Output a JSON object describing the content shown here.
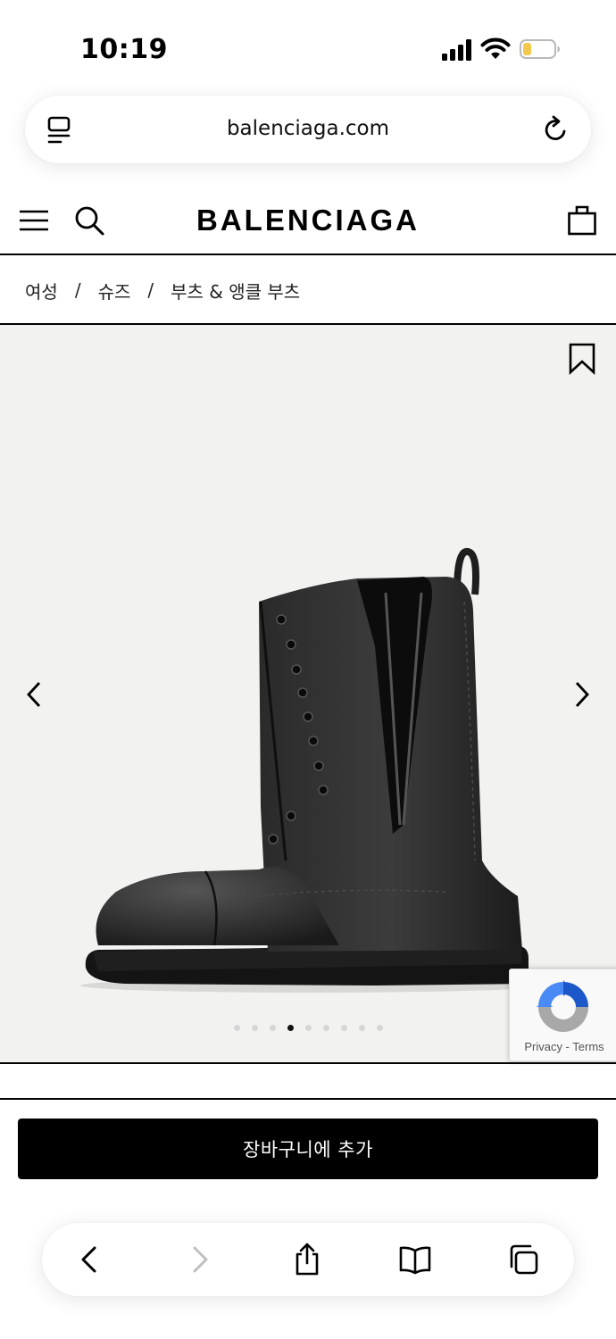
{
  "status_bar": {
    "time": "10:19",
    "icons": [
      "cellular-signal-icon",
      "wifi-icon",
      "battery-low-icon"
    ],
    "battery_color": "#f2c94c"
  },
  "browser": {
    "url": "balenciaga.com",
    "icons": [
      "tab-overview-icon",
      "reload-icon"
    ]
  },
  "header": {
    "brand": "BALENCIAGA",
    "icons": [
      "hamburger-menu-icon",
      "search-icon",
      "shopping-bag-icon"
    ]
  },
  "breadcrumb": {
    "items": [
      "여성",
      "슈즈",
      "부츠 & 앵클 부츠"
    ],
    "separator": "/"
  },
  "gallery": {
    "image_alt": "black leather boot",
    "slide_count": 9,
    "active_slide": 4,
    "background": "#f2f2f0",
    "icons": [
      "bookmark-icon",
      "chevron-left-icon",
      "chevron-right-icon"
    ]
  },
  "recaptcha": {
    "links": "Privacy - Terms"
  },
  "cta": {
    "add_to_cart": "장바구니에 추가"
  },
  "safari_toolbar": {
    "icons": [
      "back-icon",
      "forward-icon",
      "share-icon",
      "bookmarks-icon",
      "tabs-icon"
    ]
  }
}
